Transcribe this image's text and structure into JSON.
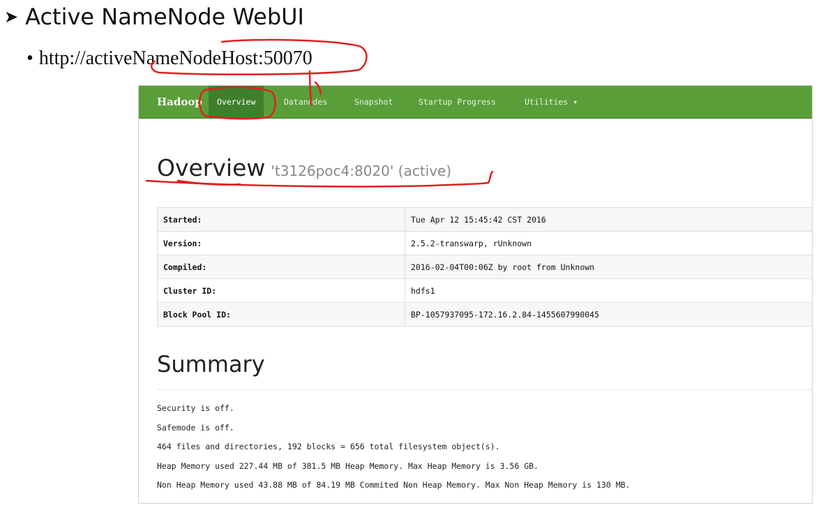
{
  "slide": {
    "title": "Active NameNode WebUI",
    "bullet": "http://activeNameNodeHost:50070"
  },
  "navbar": {
    "brand": "Hadoop",
    "items": [
      "Overview",
      "Datanodes",
      "Snapshot",
      "Startup Progress",
      "Utilities ▾"
    ],
    "active_index": 0
  },
  "overview": {
    "title": "Overview",
    "subtitle": "'t3126poc4:8020' (active)",
    "rows": [
      {
        "label": "Started:",
        "value": "Tue Apr 12 15:45:42 CST 2016"
      },
      {
        "label": "Version:",
        "value": "2.5.2-transwarp, rUnknown"
      },
      {
        "label": "Compiled:",
        "value": "2016-02-04T00:06Z by root from Unknown"
      },
      {
        "label": "Cluster ID:",
        "value": "hdfs1"
      },
      {
        "label": "Block Pool ID:",
        "value": "BP-1057937095-172.16.2.84-1455607990045"
      }
    ]
  },
  "summary": {
    "title": "Summary",
    "lines": [
      "Security is off.",
      "Safemode is off.",
      "464 files and directories, 192 blocks = 656 total filesystem object(s).",
      "Heap Memory used 227.44 MB of 381.5 MB Heap Memory. Max Heap Memory is 3.56 GB.",
      "Non Heap Memory used 43.88 MB of 84.19 MB Commited Non Heap Memory. Max Non Heap Memory is 130 MB."
    ]
  },
  "colors": {
    "navbar": "#5a9e3a",
    "navbar_active": "#3f7f2c",
    "annotation": "#e02020"
  }
}
